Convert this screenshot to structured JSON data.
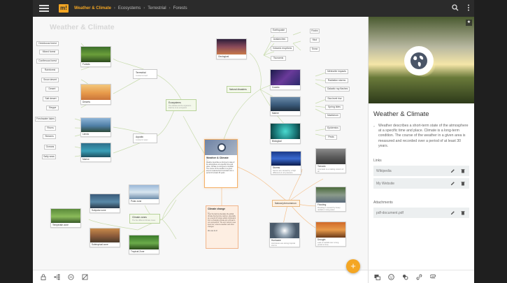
{
  "topbar": {
    "logo": "m!",
    "crumbs": [
      "Weather & Climate",
      "Ecosystems",
      "Terrestrial",
      "Forests"
    ]
  },
  "canvas": {
    "watermark": "Weather & Climate",
    "center": {
      "title": "Weather & Climate",
      "meta": "3 •",
      "body": "Weather describes a short-term state of the atmosphere at a specific time and place. Climate is a long-term condition. The course of the weather in a given area is measured and recorded over a period of at least 30 years."
    },
    "climate_change": {
      "title": "Climate change",
      "meta": "4 •",
      "body": "Over the last few decades the global climate has become warmer, especially as a result of human activity. Emissions from a changing climate are a threat to our ecosystems. The term refers to sea level rise, extreme weather and other changes.",
      "footer": "We can do it!"
    },
    "hubs": {
      "ecosystems": {
        "label": "Ecosystems",
        "sub": "The habitat and the organisms that live in an ecosystem"
      },
      "terrestrial": {
        "label": "Terrestrial",
        "sub": "Located on land"
      },
      "aquatic": {
        "label": "Aquatic",
        "sub": "Located in water"
      },
      "natural_disasters": {
        "label": "Natural disasters"
      },
      "natural_phenomenon": {
        "label": "Natural phenomenon"
      },
      "climate_zones": {
        "label": "Climate zones",
        "sub": "The five different climate zones"
      }
    },
    "cards": {
      "forests": "Forests",
      "deserts": "Deserts",
      "limnic": "Limnic",
      "marine_aq": "Marine",
      "geological": "Geological",
      "cosmic": "Cosmic",
      "marine": "Marine",
      "biological": "Biological",
      "storms": "Storms",
      "tornado": "Tornado",
      "flooding": "Flooding",
      "drought": "Drought",
      "hurricane": "Hurricane",
      "polar": "Polar zone",
      "subpolar": "Subpolar zone",
      "temperate": "Temperate zone",
      "subtropical": "Subtropical zone",
      "tropical": "Tropical Zone"
    },
    "card_texts": {
      "storms": "Storms are caused by a high difference in air pressure",
      "tornado": "A tornado is a rotating column of air",
      "flooding": "Flooding is caused by heavy rainfall or rising water",
      "drought": "Lack of rainfall over a long period of time",
      "hurricane": "Hurricanes are strong tropical storms"
    },
    "leaves_left": [
      "Deciduous forest",
      "Mixed forest",
      "Coniferous forest",
      "Rainforest",
      "Snow desert",
      "Desert",
      "Salt desert",
      "Steppe",
      "Freshwater lakes",
      "Rivers",
      "Streams",
      "Oceans",
      "Salty seas"
    ],
    "leaves_geo": [
      "Earthquake",
      "Avalanches",
      "Volcanic eruptions",
      "Tsunamis"
    ],
    "leaves_geo2": [
      "Rocks",
      "Mud",
      "Snow"
    ],
    "leaves_cosmic": [
      "Meteorite impacts",
      "Radiation storms",
      "Galactic ray flashes"
    ],
    "leaves_marine": [
      "Sea level rise",
      "Spring tides",
      "Maelstrom"
    ],
    "leaves_bio": [
      "Epidemics",
      "Pests"
    ]
  },
  "panel": {
    "title": "Weather & Climate",
    "description": "Weather describes a short-term state of the atmosphere at a specific time and place. Climate is a long-term condition. The course of the weather in a given area is measured and recorded over a period of at least 30 years.",
    "links_label": "Links",
    "links": [
      "Wikipedia",
      "My Website"
    ],
    "attachments_label": "Attachments",
    "attachments": [
      "pdf-document.pdf"
    ]
  },
  "colors": {
    "accent": "#f4a623",
    "topbar": "#2b2b2b",
    "green_line": "#b8d29a",
    "orange_line": "#f5b168"
  },
  "icons": [
    "menu-icon",
    "search-icon",
    "more-vert-icon",
    "lock-icon",
    "tree-layout-icon",
    "zoom-out-icon",
    "no-image-icon",
    "add-icon",
    "star-icon",
    "notes-icon",
    "edit-icon",
    "delete-icon",
    "card-icon",
    "emoji-icon",
    "colors-icon",
    "link-icon",
    "attachment-icon"
  ]
}
